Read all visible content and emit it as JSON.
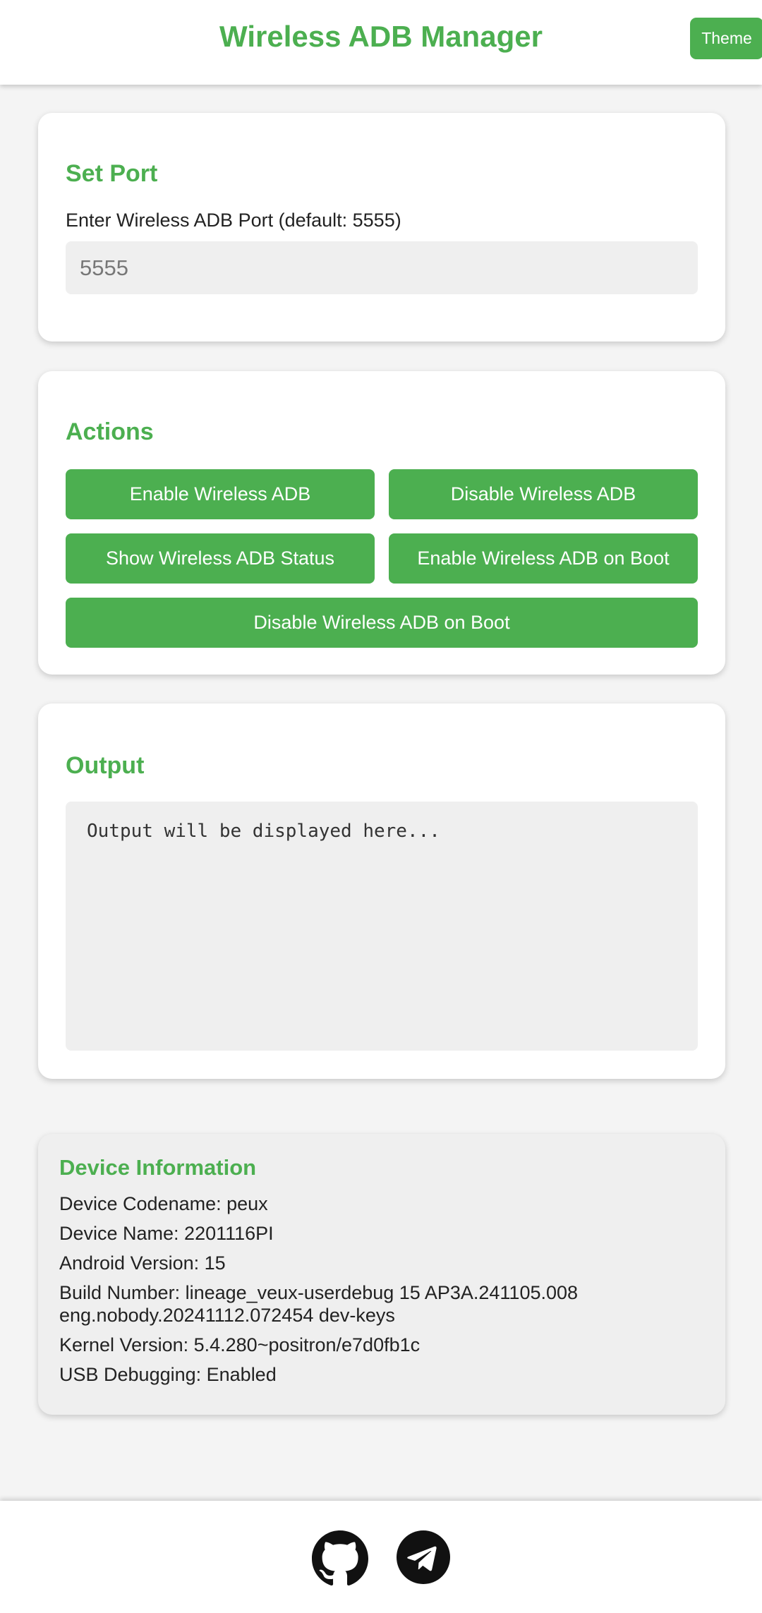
{
  "header": {
    "title": "Wireless ADB Manager",
    "theme_label": "Theme"
  },
  "port": {
    "heading": "Set Port",
    "label": "Enter Wireless ADB Port (default: 5555)",
    "value": "",
    "placeholder": "5555"
  },
  "actions": {
    "heading": "Actions",
    "buttons": [
      "Enable Wireless ADB",
      "Disable Wireless ADB",
      "Show Wireless ADB Status",
      "Enable Wireless ADB on Boot",
      "Disable Wireless ADB on Boot"
    ]
  },
  "output": {
    "heading": "Output",
    "text": "Output will be displayed here..."
  },
  "device": {
    "heading": "Device Information",
    "codename": "Device Codename: peux",
    "name": "Device Name: 2201116PI",
    "android": "Android Version: 15",
    "build": "Build Number: lineage_veux-userdebug 15 AP3A.241105.008 eng.nobody.20241112.072454 dev-keys",
    "kernel": "Kernel Version: 5.4.280~positron/e7d0fb1c",
    "usb": "USB Debugging: Enabled"
  },
  "footer": {
    "icons": [
      "github-icon",
      "telegram-icon"
    ]
  },
  "colors": {
    "accent": "#4caf50",
    "background": "#f4f4f4",
    "field": "#efefef"
  }
}
